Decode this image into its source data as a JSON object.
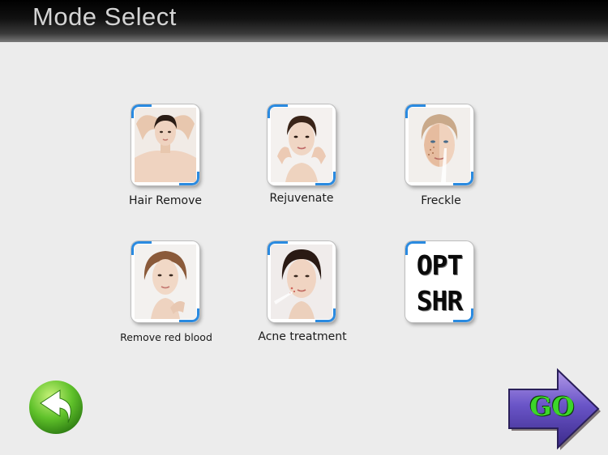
{
  "header": {
    "title": "Mode Select"
  },
  "modes": [
    {
      "label": "Hair Remove"
    },
    {
      "label": "Rejuvenate"
    },
    {
      "label": "Freckle"
    },
    {
      "label": "Remove red blood"
    },
    {
      "label": "Acne treatment"
    },
    {
      "line1": "OPT",
      "line2": "SHR"
    }
  ],
  "nav": {
    "go_label": "GO"
  },
  "colors": {
    "tile_accent": "#2a8ae0",
    "back_button": "#5fc12a",
    "go_arrow": "#6a55c8",
    "go_text": "#3cd62a"
  }
}
